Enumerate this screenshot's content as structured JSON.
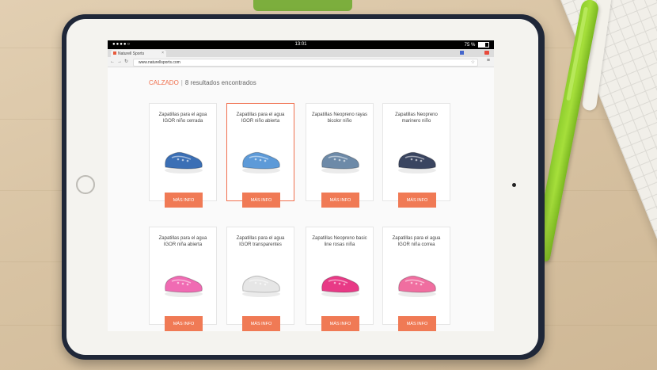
{
  "status_bar": {
    "carrier": "●●●●○",
    "time": "13:01",
    "battery": "75 %"
  },
  "browser": {
    "tab_title": "Naturell Sports",
    "url": "www.naturellsports.com"
  },
  "page": {
    "category": "CALZADO",
    "separator": "|",
    "results": "8 resultados encontrados",
    "button_label": "MÁS INFO",
    "products": [
      {
        "title": "Zapatillas para el agua IGOR niño cerrada",
        "color": "#3b6fb5",
        "selected": false
      },
      {
        "title": "Zapatillas para el agua IGOR niño abierta",
        "color": "#5d9ad8",
        "selected": true
      },
      {
        "title": "Zapatillas Neopreno rayas bicolor niño",
        "color": "#6d8aa8",
        "selected": false
      },
      {
        "title": "Zapatillas Neopreno marinero niño",
        "color": "#3a4560",
        "selected": false
      },
      {
        "title": "Zapatillas para el agua IGOR niña abierta",
        "color": "#f06bb3",
        "selected": false
      },
      {
        "title": "Zapatillas para el agua IGOR transparentes",
        "color": "#e6e6e6",
        "selected": false
      },
      {
        "title": "Zapatillas Neopreno basic line rosas niña",
        "color": "#e83a86",
        "selected": false
      },
      {
        "title": "Zapatillas para el agua IGOR niña correa",
        "color": "#f06ea0",
        "selected": false
      }
    ]
  },
  "colors": {
    "accent": "#f07a55",
    "pen": "#a6df3b",
    "tablet_case": "#1f2738"
  }
}
